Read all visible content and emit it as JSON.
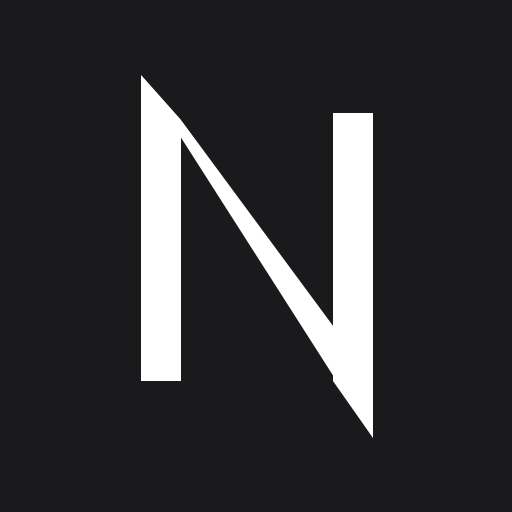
{
  "app_icon": {
    "logo_text": "N",
    "icon": "letter-n-logo-icon",
    "colors": {
      "background": "#1a1a1c",
      "logo": "#ffffff"
    }
  }
}
